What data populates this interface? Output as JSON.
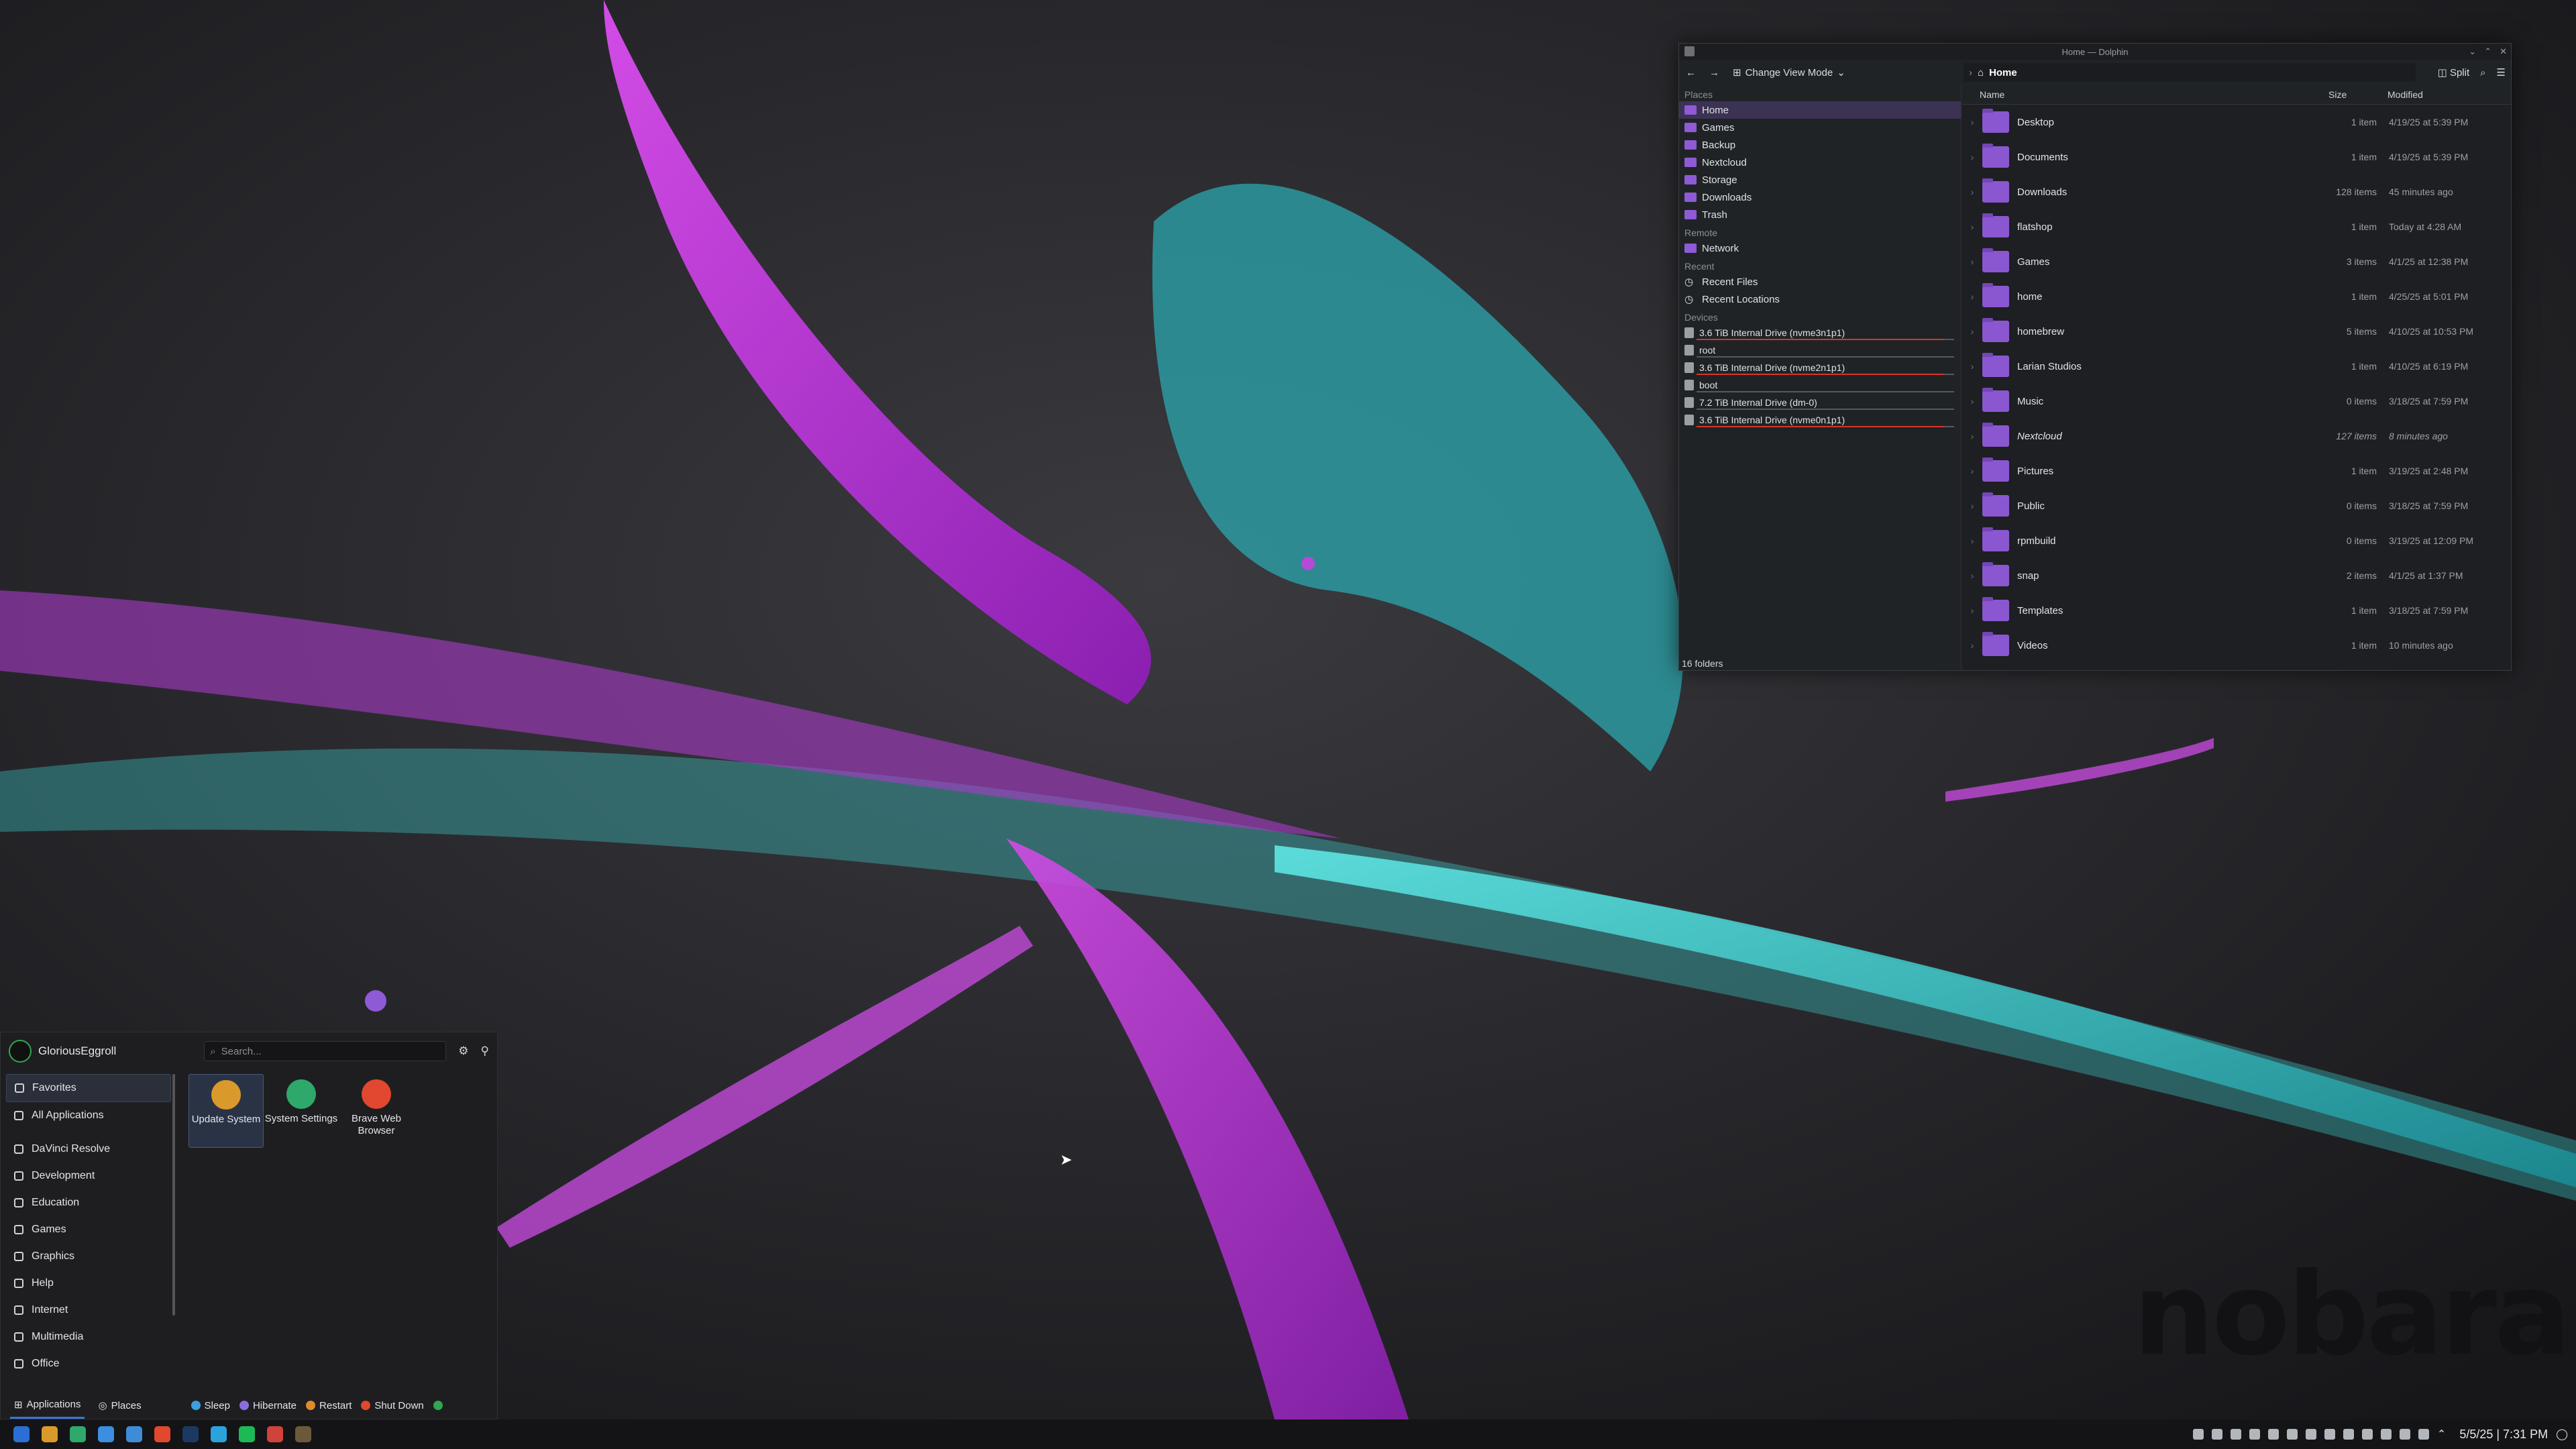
{
  "colors": {
    "accent": "#8e5ad6",
    "selection": "#3b3254",
    "alert_bar": "#d9342b",
    "launcher_accent": "#3d74d8"
  },
  "wallpaper": {
    "brand": "nobara"
  },
  "dolphin": {
    "title": "Home — Dolphin",
    "toolbar": {
      "view_mode": "Change View Mode",
      "split": "Split"
    },
    "path": "Home",
    "places": {
      "places_label": "Places",
      "items": [
        {
          "label": "Home",
          "icon": "home-folder-icon"
        },
        {
          "label": "Games",
          "icon": "folder-icon"
        },
        {
          "label": "Backup",
          "icon": "folder-icon"
        },
        {
          "label": "Nextcloud",
          "icon": "folder-icon"
        },
        {
          "label": "Storage",
          "icon": "folder-icon"
        },
        {
          "label": "Downloads",
          "icon": "folder-icon"
        },
        {
          "label": "Trash",
          "icon": "trash-icon"
        }
      ],
      "remote_label": "Remote",
      "remote": [
        {
          "label": "Network",
          "icon": "network-icon"
        }
      ],
      "recent_label": "Recent",
      "recent": [
        {
          "label": "Recent Files",
          "icon": "clock-icon"
        },
        {
          "label": "Recent Locations",
          "icon": "clock-icon"
        }
      ],
      "devices_label": "Devices",
      "devices": [
        {
          "label": "3.6 TiB Internal Drive (nvme3n1p1)",
          "usage": 0.96
        },
        {
          "label": "root",
          "usage": 0
        },
        {
          "label": "3.6 TiB Internal Drive (nvme2n1p1)",
          "usage": 0.96
        },
        {
          "label": "boot",
          "usage": 0
        },
        {
          "label": "7.2 TiB Internal Drive (dm-0)",
          "usage": 0
        },
        {
          "label": "3.6 TiB Internal Drive (nvme0n1p1)",
          "usage": 0.96
        }
      ]
    },
    "columns": {
      "name": "Name",
      "size": "Size",
      "modified": "Modified"
    },
    "files": [
      {
        "name": "Desktop",
        "size": "1 item",
        "modified": "4/19/25 at 5:39 PM"
      },
      {
        "name": "Documents",
        "size": "1 item",
        "modified": "4/19/25 at 5:39 PM"
      },
      {
        "name": "Downloads",
        "size": "128 items",
        "modified": "45 minutes ago"
      },
      {
        "name": "flatshop",
        "size": "1 item",
        "modified": "Today at 4:28 AM"
      },
      {
        "name": "Games",
        "size": "3 items",
        "modified": "4/1/25 at 12:38 PM"
      },
      {
        "name": "home",
        "size": "1 item",
        "modified": "4/25/25 at 5:01 PM"
      },
      {
        "name": "homebrew",
        "size": "5 items",
        "modified": "4/10/25 at 10:53 PM"
      },
      {
        "name": "Larian Studios",
        "size": "1 item",
        "modified": "4/10/25 at 6:19 PM"
      },
      {
        "name": "Music",
        "size": "0 items",
        "modified": "3/18/25 at 7:59 PM"
      },
      {
        "name": "Nextcloud",
        "size": "127 items",
        "modified": "8 minutes ago",
        "italic": true
      },
      {
        "name": "Pictures",
        "size": "1 item",
        "modified": "3/19/25 at 2:48 PM"
      },
      {
        "name": "Public",
        "size": "0 items",
        "modified": "3/18/25 at 7:59 PM"
      },
      {
        "name": "rpmbuild",
        "size": "0 items",
        "modified": "3/19/25 at 12:09 PM"
      },
      {
        "name": "snap",
        "size": "2 items",
        "modified": "4/1/25 at 1:37 PM"
      },
      {
        "name": "Templates",
        "size": "1 item",
        "modified": "3/18/25 at 7:59 PM"
      },
      {
        "name": "Videos",
        "size": "1 item",
        "modified": "10 minutes ago"
      }
    ],
    "status": "16 folders"
  },
  "launcher": {
    "user": "GloriousEggroll",
    "search_placeholder": "Search...",
    "categories": [
      {
        "label": "Favorites",
        "icon": "bookmark-icon"
      },
      {
        "label": "All Applications",
        "icon": "grid-icon"
      },
      {
        "label": "DaVinci Resolve",
        "icon": "davinci-icon"
      },
      {
        "label": "Development",
        "icon": "wrench-icon"
      },
      {
        "label": "Education",
        "icon": "education-icon"
      },
      {
        "label": "Games",
        "icon": "gamepad-icon"
      },
      {
        "label": "Graphics",
        "icon": "graphics-icon"
      },
      {
        "label": "Help",
        "icon": "help-icon"
      },
      {
        "label": "Internet",
        "icon": "globe-icon"
      },
      {
        "label": "Multimedia",
        "icon": "multimedia-icon"
      },
      {
        "label": "Office",
        "icon": "office-icon"
      }
    ],
    "apps": [
      {
        "label": "Update System",
        "icon": "update-system-icon",
        "color": "#d99a2b"
      },
      {
        "label": "System Settings",
        "icon": "system-settings-icon",
        "color": "#2fa86b"
      },
      {
        "label": "Brave Web Browser",
        "icon": "brave-icon",
        "color": "#e2472f"
      }
    ],
    "footer": {
      "applications": "Applications",
      "places": "Places",
      "sleep": "Sleep",
      "hibernate": "Hibernate",
      "restart": "Restart",
      "shutdown": "Shut Down"
    }
  },
  "taskbar": {
    "apps": [
      {
        "icon": "app-grid-icon",
        "color": "#2b6fd6"
      },
      {
        "icon": "update-icon",
        "color": "#d99a2b"
      },
      {
        "icon": "system-settings-icon",
        "color": "#2fa86b"
      },
      {
        "icon": "discover-icon",
        "color": "#3b8ee0"
      },
      {
        "icon": "dolphin-icon",
        "color": "#3e8cd8"
      },
      {
        "icon": "brave-icon",
        "color": "#e2472f"
      },
      {
        "icon": "steam-icon",
        "color": "#1b3a62"
      },
      {
        "icon": "telegram-icon",
        "color": "#2aa3dc"
      },
      {
        "icon": "spotify-icon",
        "color": "#1db954"
      },
      {
        "icon": "chrome-icon",
        "color": "#d0433a"
      },
      {
        "icon": "game-icon",
        "color": "#6b5a3a"
      }
    ],
    "clock": "5/5/25 | 7:31 PM"
  }
}
